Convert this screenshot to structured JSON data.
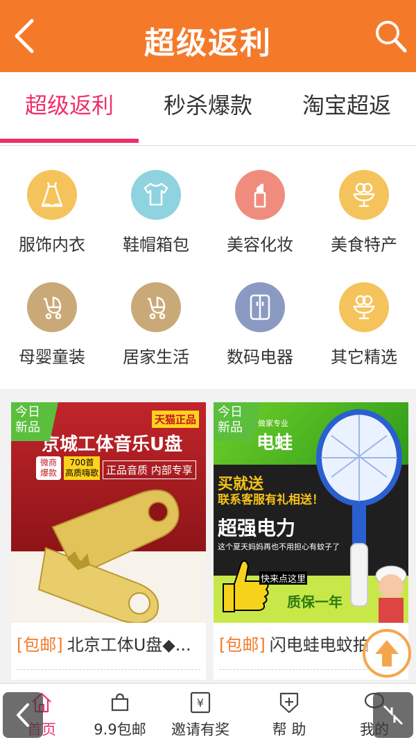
{
  "header": {
    "title": "超级返利",
    "back_icon": "back-arrow-icon",
    "search_icon": "search-icon"
  },
  "tabs": [
    {
      "label": "超级返利",
      "active": true
    },
    {
      "label": "秒杀爆款",
      "active": false
    },
    {
      "label": "淘宝超返",
      "active": false
    }
  ],
  "categories": [
    {
      "label": "服饰内衣",
      "icon": "dress-icon",
      "color": "#f5c35b"
    },
    {
      "label": "鞋帽箱包",
      "icon": "tshirt-icon",
      "color": "#8ed3df"
    },
    {
      "label": "美容化妆",
      "icon": "lipstick-icon",
      "color": "#ef8c7e"
    },
    {
      "label": "美食特产",
      "icon": "icecream-icon",
      "color": "#f5c35b"
    },
    {
      "label": "母婴童装",
      "icon": "stroller-icon",
      "color": "#caa978"
    },
    {
      "label": "居家生活",
      "icon": "stroller-icon",
      "color": "#caa978"
    },
    {
      "label": "数码电器",
      "icon": "fridge-icon",
      "color": "#8a9ac2"
    },
    {
      "label": "其它精选",
      "icon": "icecream-icon",
      "color": "#f5c35b"
    }
  ],
  "products": [
    {
      "ribbon": "今日新品",
      "tag": "[包邮]",
      "title": "北京工体U盘◆...",
      "banner": {
        "badge": "天猫正品",
        "headline": "京城工体音乐U盘",
        "side_tag_1": "微商爆款",
        "side_tag_2": "700首 高质嗨歌",
        "sub": "正品音质 内部专享"
      }
    },
    {
      "ribbon": "今日新品",
      "tag": "[包邮]",
      "title": "闪电蛙电蚊拍",
      "banner": {
        "top": "电蛙",
        "top_small": "做家专业",
        "gift": "买就送",
        "gift2": "联系客服有礼相送！",
        "power": "超强电力",
        "sub": "这个夏天妈妈再也不用担心有蚊子了",
        "click": "快来点这里",
        "warranty": "质保一年"
      }
    }
  ],
  "bottom_nav": [
    {
      "label": "首页",
      "icon": "home-icon",
      "active": true
    },
    {
      "label": "9.9包邮",
      "icon": "bag-icon",
      "active": false
    },
    {
      "label": "邀请有奖",
      "icon": "invite-icon",
      "active": false
    },
    {
      "label": "帮 助",
      "icon": "help-icon",
      "active": false
    },
    {
      "label": "我的",
      "icon": "user-icon",
      "active": false
    }
  ],
  "colors": {
    "header": "#f47a2a",
    "accent": "#f0306a",
    "tag": "#f47a2a"
  }
}
